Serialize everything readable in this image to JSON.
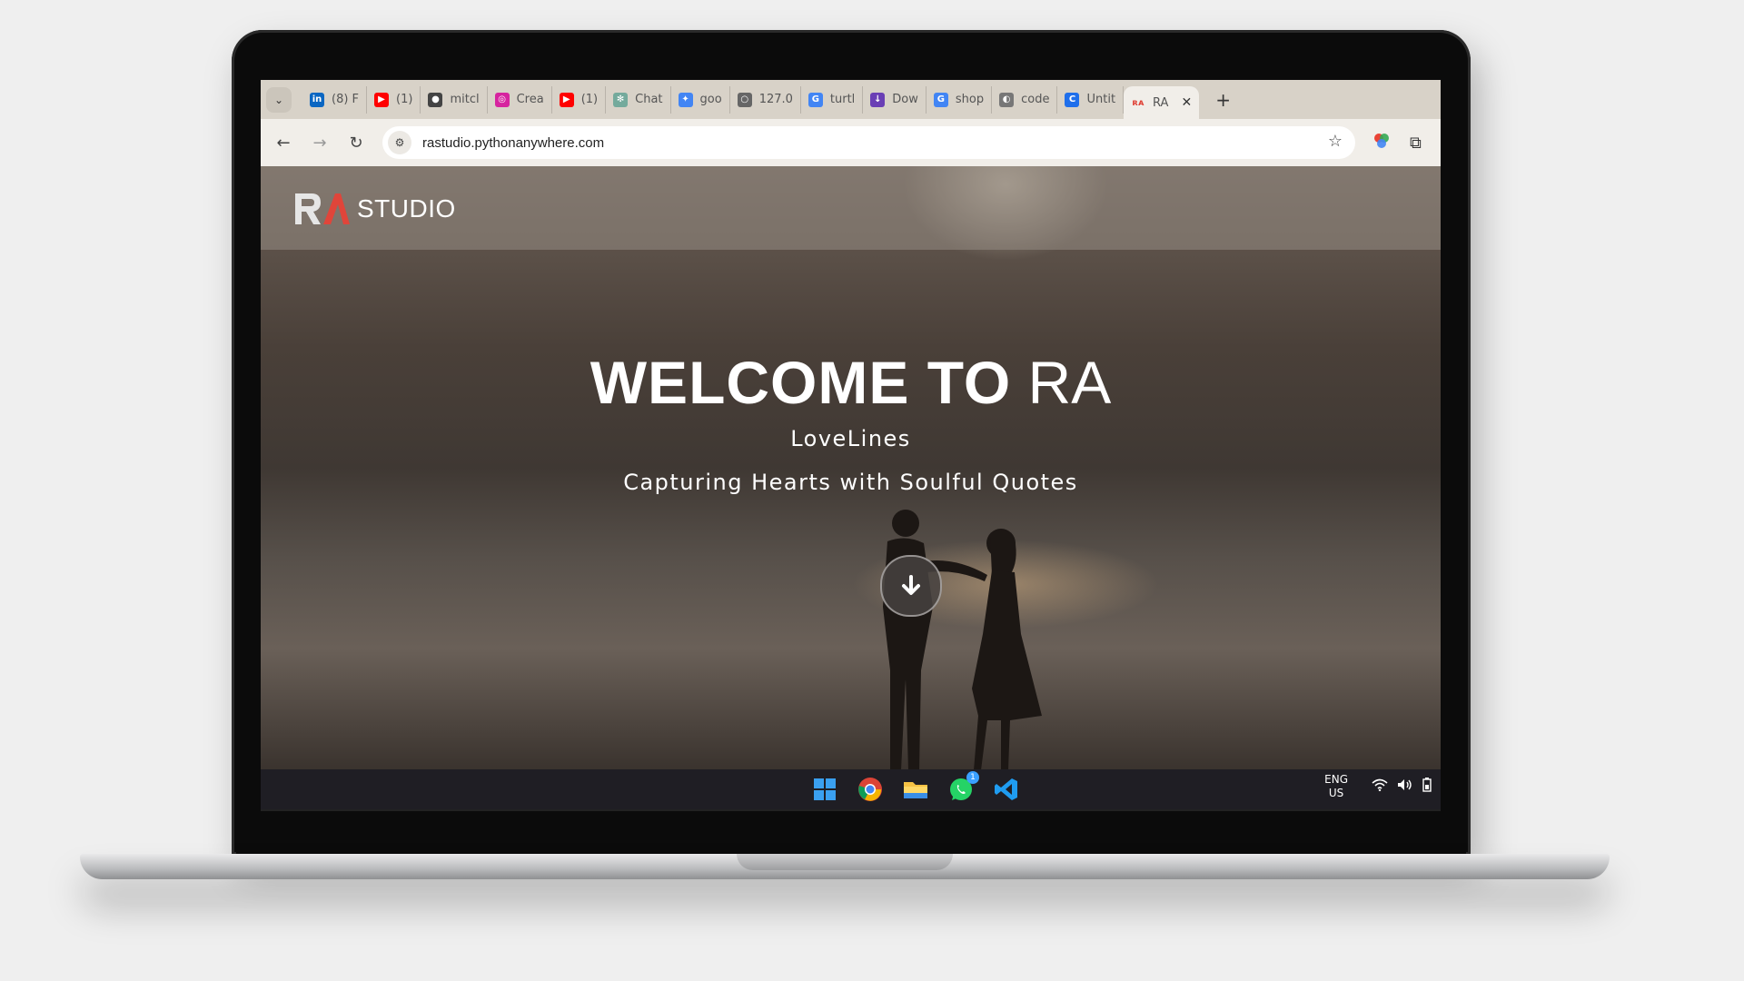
{
  "browser": {
    "tabs": [
      {
        "label": "(8) F",
        "favicon": "linkedin-icon",
        "color": "#0a66c2",
        "glyph": "in"
      },
      {
        "label": "(1)",
        "favicon": "youtube-icon",
        "color": "#ff0000",
        "glyph": "▶"
      },
      {
        "label": "mitcl",
        "favicon": "github-icon",
        "color": "#444444",
        "glyph": "●"
      },
      {
        "label": "Crea",
        "favicon": "instagram-icon",
        "color": "#d6249f",
        "glyph": "◎"
      },
      {
        "label": "(1)",
        "favicon": "youtube-icon",
        "color": "#ff0000",
        "glyph": "▶"
      },
      {
        "label": "Chat",
        "favicon": "chatgpt-icon",
        "color": "#74aa9c",
        "glyph": "✻"
      },
      {
        "label": "goo",
        "favicon": "gemini-icon",
        "color": "#4285f4",
        "glyph": "✦"
      },
      {
        "label": "127.0",
        "favicon": "globe-icon",
        "color": "#666666",
        "glyph": "○"
      },
      {
        "label": "turtl",
        "favicon": "google-icon",
        "color": "#4285f4",
        "glyph": "G"
      },
      {
        "label": "Dow",
        "favicon": "download-icon",
        "color": "#6a3fb5",
        "glyph": "↓"
      },
      {
        "label": "shop",
        "favicon": "google-icon",
        "color": "#4285f4",
        "glyph": "G"
      },
      {
        "label": "code",
        "favicon": "code-icon",
        "color": "#777777",
        "glyph": "◐"
      },
      {
        "label": "Untit",
        "favicon": "canva-icon",
        "color": "#1f6feb",
        "glyph": "C"
      }
    ],
    "active_tab": {
      "label": "RA",
      "close": "✕"
    },
    "new_tab": "+",
    "url": "rastudio.pythonanywhere.com"
  },
  "site": {
    "logo_text": "STUDIO",
    "hero_title_bold": "WELCOME TO",
    "hero_title_thin": "RA",
    "subtitle": "LoveLines",
    "tagline": "Capturing Hearts with Soulful Quotes"
  },
  "taskbar": {
    "lang_line1": "ENG",
    "lang_line2": "US",
    "whatsapp_badge": "1"
  }
}
